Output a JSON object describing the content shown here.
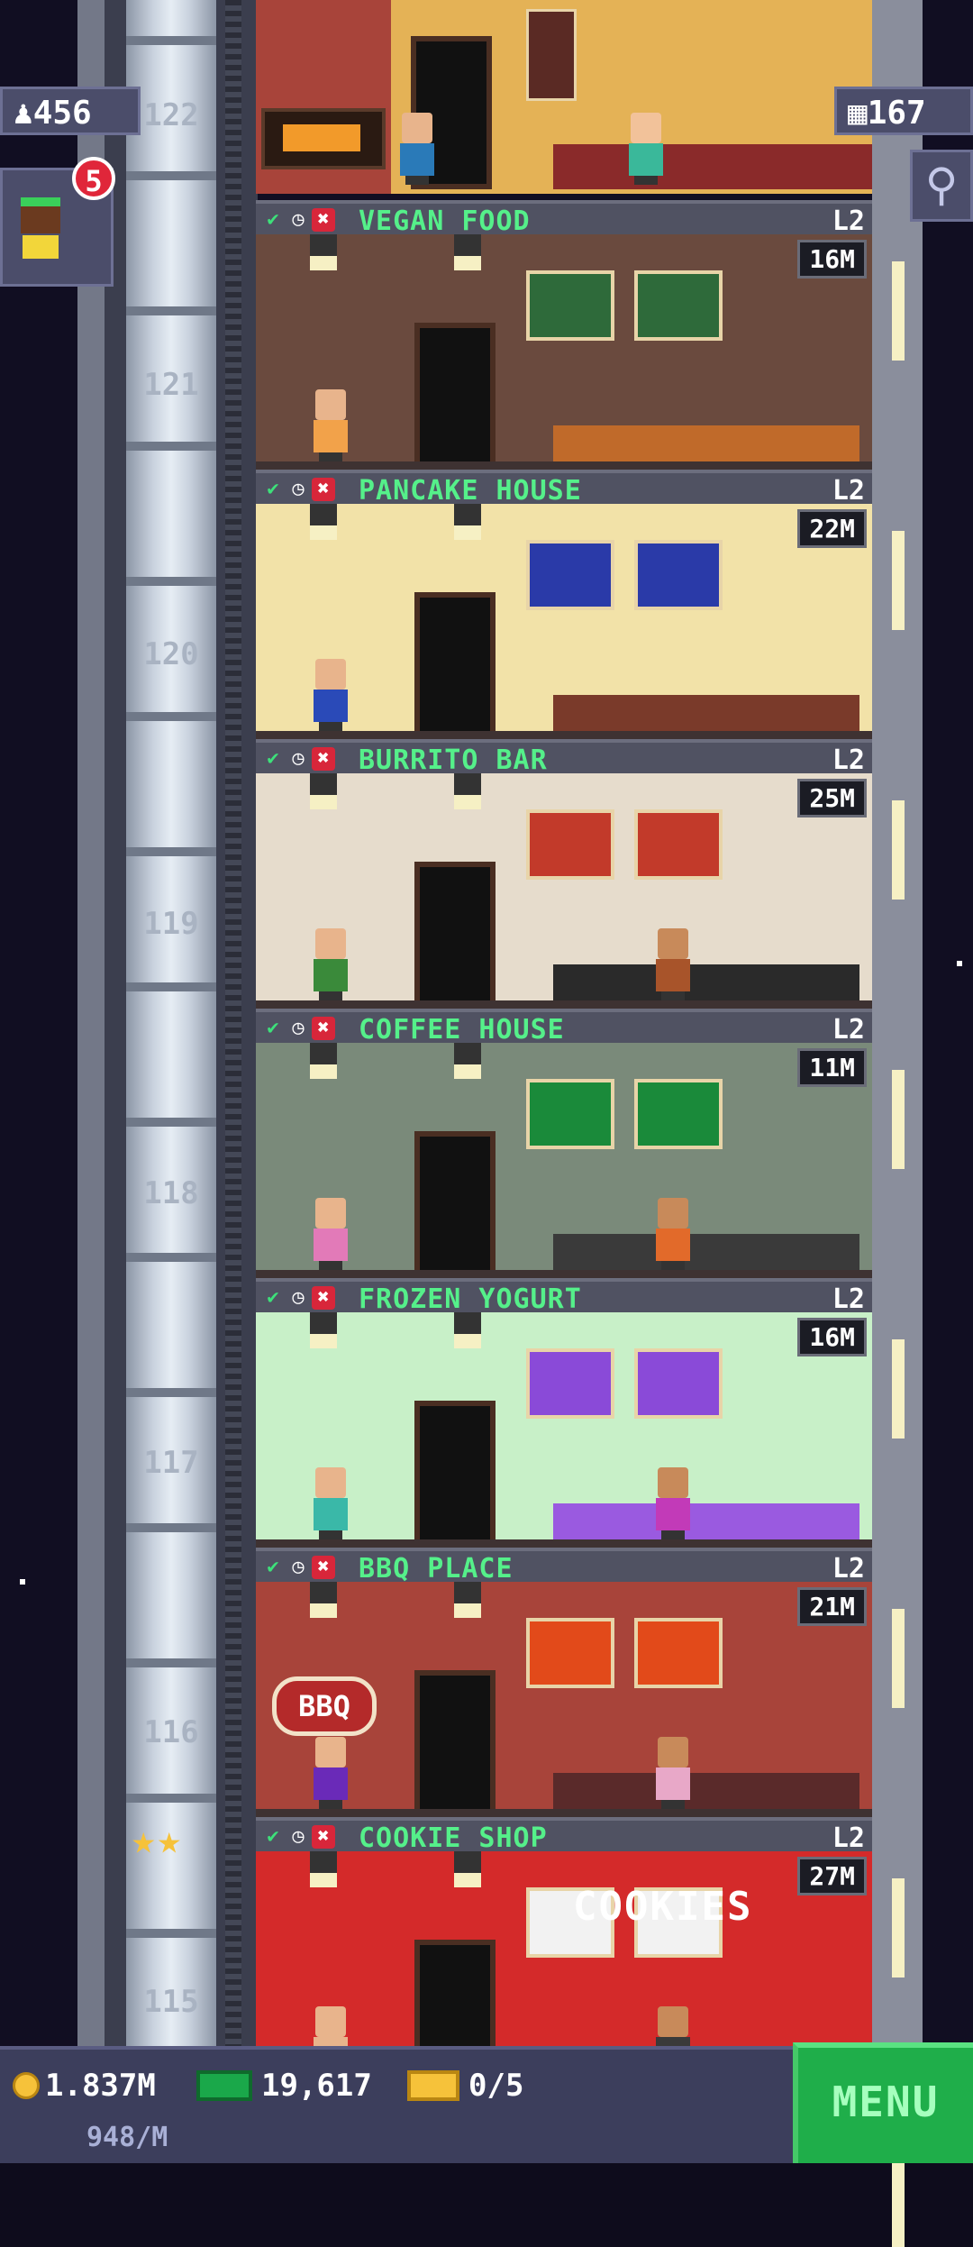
{
  "hud": {
    "population": "456",
    "population_icon": "person-icon",
    "notifications": "5",
    "bux_count": "167",
    "bux_icon": "building-icon",
    "search_icon": "magnifier-icon"
  },
  "elevator": {
    "floor_numbers": [
      "122",
      "121",
      "120",
      "119",
      "118",
      "117",
      "116",
      "115"
    ]
  },
  "floors": [
    {
      "name": "VEGAN FOOD",
      "level": "L2",
      "stock": "16M"
    },
    {
      "name": "PANCAKE HOUSE",
      "level": "L2",
      "stock": "22M"
    },
    {
      "name": "BURRITO BAR",
      "level": "L2",
      "stock": "25M"
    },
    {
      "name": "COFFEE HOUSE",
      "level": "L2",
      "stock": "11M"
    },
    {
      "name": "FROZEN YOGURT",
      "level": "L2",
      "stock": "16M"
    },
    {
      "name": "BBQ PLACE",
      "level": "L2",
      "stock": "21M"
    },
    {
      "name": "COOKIE SHOP",
      "level": "L2",
      "stock": "27M"
    }
  ],
  "signs": {
    "bbq": "BBQ",
    "cookies": "COOKIES"
  },
  "stars": "★★",
  "bottom": {
    "coins": "1.837M",
    "coin_rate": "948/M",
    "bux": "19,617",
    "tickets": "0/5",
    "menu_label": "MENU"
  },
  "colors": {
    "header_text": "#55f08a",
    "menu_bg": "#1fae4a",
    "hud_bg": "#4b4d6a"
  }
}
